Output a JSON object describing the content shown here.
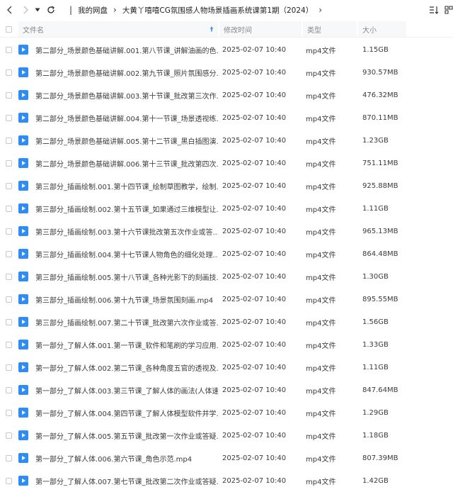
{
  "topbar": {
    "breadcrumbs": [
      "我的网盘",
      "大黄丫嘻嘻CG氛围感人物场景插画系统课第1期（2024）"
    ]
  },
  "header": {
    "name": "文件名",
    "time": "修改时间",
    "type": "类型",
    "size": "大小"
  },
  "files": [
    {
      "name": "第二部分_场景颜色基础讲解.001.第八节课_讲解油画的色...",
      "time": "2025-02-07 10:40",
      "type": "mp4文件",
      "size": "1.15GB"
    },
    {
      "name": "第二部分_场景颜色基础讲解.002.第九节课_照片氛围感分...",
      "time": "2025-02-07 10:40",
      "type": "mp4文件",
      "size": "930.57MB"
    },
    {
      "name": "第二部分_场景颜色基础讲解.003.第十节课_批改第三次作...",
      "time": "2025-02-07 10:40",
      "type": "mp4文件",
      "size": "476.32MB"
    },
    {
      "name": "第二部分_场景颜色基础讲解.004.第十一节课_场景透视练...",
      "time": "2025-02-07 10:40",
      "type": "mp4文件",
      "size": "870.11MB"
    },
    {
      "name": "第二部分_场景颜色基础讲解.005.第十二节课_黑白插图演...",
      "time": "2025-02-07 10:40",
      "type": "mp4文件",
      "size": "1.23GB"
    },
    {
      "name": "第二部分_场景颜色基础讲解.006.第十三节课_批改第四次...",
      "time": "2025-02-07 10:40",
      "type": "mp4文件",
      "size": "751.11MB"
    },
    {
      "name": "第三部分_插画绘制.001.第十四节课_绘制草图教学，绘制...",
      "time": "2025-02-07 10:40",
      "type": "mp4文件",
      "size": "925.88MB"
    },
    {
      "name": "第三部分_插画绘制.002.第十五节课_如果通过三维模型让...",
      "time": "2025-02-07 10:40",
      "type": "mp4文件",
      "size": "1.11GB"
    },
    {
      "name": "第三部分_插画绘制.003.第十六节课批改第五次作业或答...",
      "time": "2025-02-07 10:40",
      "type": "mp4文件",
      "size": "965.13MB"
    },
    {
      "name": "第三部分_插画绘制.004.第十七节课人物角色的细化处理...",
      "time": "2025-02-07 10:40",
      "type": "mp4文件",
      "size": "864.48MB"
    },
    {
      "name": "第三部分_插画绘制.005.第十八节课_各种光影下的刻画技...",
      "time": "2025-02-07 10:40",
      "type": "mp4文件",
      "size": "1.30GB"
    },
    {
      "name": "第三部分_插画绘制.006.第十九节课_场景氛围刻画.mp4",
      "time": "2025-02-07 10:40",
      "type": "mp4文件",
      "size": "895.55MB"
    },
    {
      "name": "第三部分_插画绘制.007.第二十节课_批改第六次作业或答...",
      "time": "2025-02-07 10:40",
      "type": "mp4文件",
      "size": "1.56GB"
    },
    {
      "name": "第一部分_了解人体.001.第一节课_软件和笔刷的学习应用...",
      "time": "2025-02-07 10:40",
      "type": "mp4文件",
      "size": "1.33GB"
    },
    {
      "name": "第一部分_了解人体.002.第二节课_各种角度五官的透视及...",
      "time": "2025-02-07 10:40",
      "type": "mp4文件",
      "size": "1.11GB"
    },
    {
      "name": "第一部分_了解人体.003.第三节课_了解人体的画法(人体速...",
      "time": "2025-02-07 10:40",
      "type": "mp4文件",
      "size": "847.64MB"
    },
    {
      "name": "第一部分_了解人体.004.第四节课_了解人体模型软件并学...",
      "time": "2025-02-07 10:40",
      "type": "mp4文件",
      "size": "1.29GB"
    },
    {
      "name": "第一部分_了解人体.005.第五节课_批改第一次作业或答疑...",
      "time": "2025-02-07 10:40",
      "type": "mp4文件",
      "size": "1.18GB"
    },
    {
      "name": "第一部分_了解人体.006.第六节课_角色示范.mp4",
      "time": "2025-02-07 10:40",
      "type": "mp4文件",
      "size": "807.39MB"
    },
    {
      "name": "第一部分_了解人体.007.第七节课_批改第二次作业或答疑...",
      "time": "2025-02-07 10:40",
      "type": "mp4文件",
      "size": "1.42GB"
    }
  ]
}
